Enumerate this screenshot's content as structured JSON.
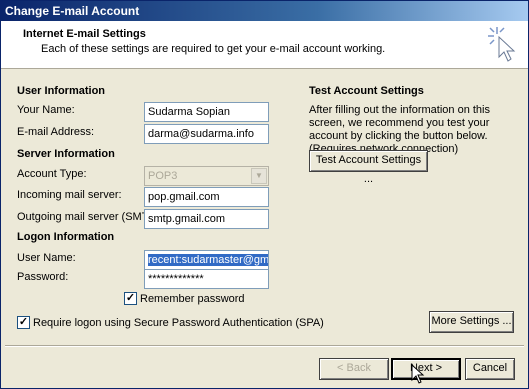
{
  "window": {
    "title": "Change E-mail Account"
  },
  "header": {
    "title": "Internet E-mail Settings",
    "subtitle": "Each of these settings are required to get your e-mail account working."
  },
  "user_info": {
    "section": "User Information",
    "name_label": "Your Name:",
    "name_value": "Sudarma Sopian",
    "email_label": "E-mail Address:",
    "email_value": "darma@sudarma.info"
  },
  "server_info": {
    "section": "Server Information",
    "type_label": "Account Type:",
    "type_value": "POP3",
    "incoming_label": "Incoming mail server:",
    "incoming_value": "pop.gmail.com",
    "outgoing_label": "Outgoing mail server (SMTP):",
    "outgoing_value": "smtp.gmail.com"
  },
  "logon_info": {
    "section": "Logon Information",
    "user_label": "User Name:",
    "user_value": "recent:sudarmaster@gmail.co",
    "password_label": "Password:",
    "password_value": "*************",
    "remember_label": "Remember password",
    "remember_checked": "✓",
    "spa_label": "Require logon using Secure Password Authentication (SPA)",
    "spa_checked": "✓"
  },
  "test": {
    "section": "Test Account Settings",
    "description": "After filling out the information on this screen, we recommend you test your account by clicking the button below. (Requires network connection)",
    "button": "Test Account Settings ..."
  },
  "buttons": {
    "more": "More Settings ...",
    "back": "< Back",
    "next": "Next >",
    "cancel": "Cancel"
  }
}
